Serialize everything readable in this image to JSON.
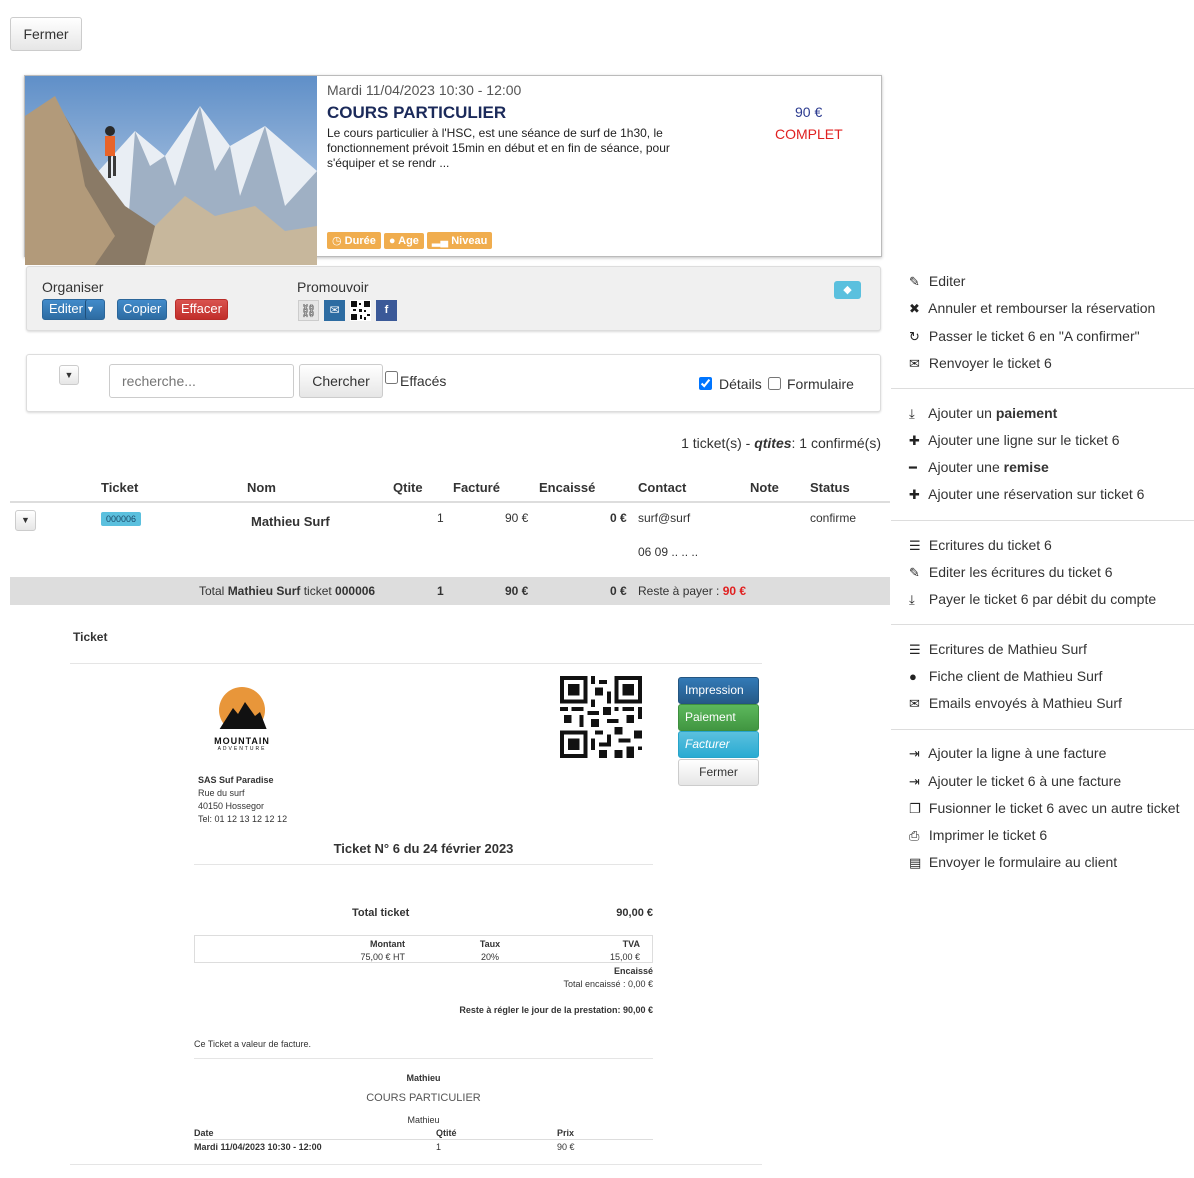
{
  "top": {
    "close_label": "Fermer"
  },
  "event": {
    "datetime": "Mardi 11/04/2023 10:30 - 12:00",
    "title": "COURS PARTICULIER",
    "description": "Le cours particulier à l'HSC, est une séance de surf de 1h30, le fonctionnement prévoit 15min en début et en fin de séance, pour s'équiper et se rendr ...",
    "price": "90 €",
    "status": "COMPLET",
    "tags": [
      "Durée",
      "Age",
      "Niveau"
    ]
  },
  "organiser": {
    "label": "Organiser",
    "edit": "Editer",
    "copy": "Copier",
    "delete": "Effacer"
  },
  "promouvoir": {
    "label": "Promouvoir"
  },
  "search": {
    "placeholder": "recherche...",
    "button": "Chercher",
    "deleted_label": "Effacés",
    "details_label": "Détails",
    "form_label": "Formulaire",
    "details_checked": true,
    "deleted_checked": false,
    "form_checked": false
  },
  "summary": {
    "count": "1 ticket(s) - ",
    "qtites_label": "qtites",
    "rest": ": 1 confirmé(s)"
  },
  "table": {
    "headers": [
      "Ticket",
      "Nom",
      "Qtite",
      "Facturé",
      "Encaissé",
      "Contact",
      "Note",
      "Status"
    ],
    "row": {
      "ticket": "000006",
      "name": "Mathieu Surf",
      "qty": "1",
      "billed": "90 €",
      "cashed": "0 €",
      "email": "surf@surf",
      "phone": "06 09 .. .. ..",
      "status": "confirme"
    },
    "total": {
      "prefix": "Total ",
      "name": "Mathieu Surf",
      "mid": " ticket ",
      "ticket": "000006",
      "qty": "1",
      "billed": "90 €",
      "cashed": "0 €",
      "rest_label": "Reste à payer : ",
      "rest_value": "90 €"
    }
  },
  "ticket_doc": {
    "section_label": "Ticket",
    "logo_line1": "MOUNTAIN",
    "logo_line2": "ADVENTURE",
    "company": "SAS Suf Paradise",
    "address1": "Rue du surf",
    "address2": "40150 Hossegor",
    "tel": "Tel: 01 12 13 12 12 12",
    "buttons": {
      "print": "Impression",
      "payment": "Paiement",
      "invoice": "Facturer",
      "close": "Fermer"
    },
    "title": "Ticket N° 6 du 24 février 2023",
    "total_label": "Total ticket",
    "total_value": "90,00 €",
    "tax_headers": [
      "Montant",
      "Taux",
      "TVA"
    ],
    "tax_values": [
      "75,00 € HT",
      "20%",
      "15,00 €"
    ],
    "cashed_label": "Encaissé",
    "cashed_total": "Total encaissé : 0,00 €",
    "due": "Reste à régler le jour de la prestation: 90,00 €",
    "note": "Ce Ticket a valeur de facture.",
    "customer": "Mathieu",
    "course": "COURS PARTICULIER",
    "participant": "Mathieu",
    "line_headers": [
      "Date",
      "Qtité",
      "Prix"
    ],
    "line_values": [
      "Mardi 11/04/2023 10:30 - 12:00",
      "1",
      "90 €"
    ]
  },
  "side_menu": {
    "g1": [
      "Editer",
      "Annuler et rembourser la réservation",
      "Passer le ticket 6 en \"A confirmer\"",
      "Renvoyer le ticket 6"
    ],
    "g2": {
      "add_payment_prefix": "Ajouter un ",
      "add_payment_bold": "paiement",
      "add_line": "Ajouter une ligne sur le ticket 6",
      "add_discount_prefix": "Ajouter une ",
      "add_discount_bold": "remise",
      "add_booking": "Ajouter une réservation sur ticket 6"
    },
    "g3": [
      "Ecritures du ticket 6",
      "Editer les écritures du ticket 6",
      "Payer le ticket 6 par débit du compte"
    ],
    "g4": [
      "Ecritures de Mathieu Surf",
      "Fiche client de Mathieu Surf",
      "Emails envoyés à Mathieu Surf"
    ],
    "g5": [
      "Ajouter la ligne à une facture",
      "Ajouter le ticket 6 à une facture",
      "Fusionner le ticket 6 avec un autre ticket",
      "Imprimer le ticket 6",
      "Envoyer le formulaire au client"
    ]
  }
}
